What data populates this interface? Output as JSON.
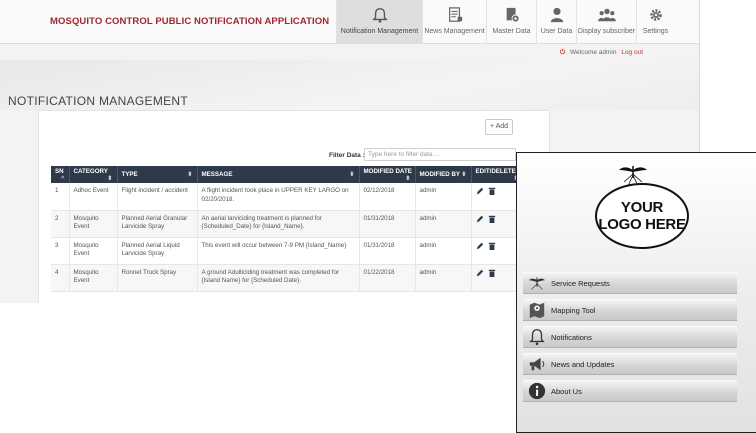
{
  "app": {
    "title": "MOSQUITO CONTROL PUBLIC NOTIFICATION APPLICATION"
  },
  "nav": {
    "items": [
      {
        "label": "Notification Management",
        "icon": "bell-icon",
        "active": true
      },
      {
        "label": "News Management",
        "icon": "news-icon",
        "active": false
      },
      {
        "label": "Master Data",
        "icon": "database-icon",
        "active": false
      },
      {
        "label": "User Data",
        "icon": "user-icon",
        "active": false
      },
      {
        "label": "Display subscriber",
        "icon": "group-icon",
        "active": false
      },
      {
        "label": "Settings",
        "icon": "gear-icon",
        "active": false
      }
    ]
  },
  "header": {
    "welcome": "Welcome admin",
    "logout": "Log out"
  },
  "page": {
    "title": "NOTIFICATION MANAGEMENT",
    "add_label": "+ Add",
    "filter_label": "Filter Data :",
    "filter_placeholder": "Type here to filter data ..."
  },
  "table": {
    "columns": [
      "SN",
      "CATEGORY",
      "TYPE",
      "MESSAGE",
      "MODIFIED DATE",
      "MODIFIED BY",
      "EDIT/DELETE"
    ],
    "rows": [
      {
        "sn": "1",
        "category": "Adhoc Event",
        "type": "Flight incident / accident",
        "message": "A flight incident took place in UPPER KEY LARGO on 02/20/2018.",
        "modified_date": "02/12/2018",
        "modified_by": "admin"
      },
      {
        "sn": "2",
        "category": "Mosquito Event",
        "type": "Planned Aerial Granular Larvicide Spray",
        "message": "An aerial larviciding treatment is planned for {Scheduled_Date} for {Island_Name}.",
        "modified_date": "01/31/2018",
        "modified_by": "admin"
      },
      {
        "sn": "3",
        "category": "Mosquito Event",
        "type": "Planned Aerial Liquid Larvicide Spray",
        "message": "This event will occur between 7-9 PM {Island_Name}",
        "modified_date": "01/31/2018",
        "modified_by": "admin"
      },
      {
        "sn": "4",
        "category": "Mosquito Event",
        "type": "Ronnet Truck Spray",
        "message": "A ground Adulticiding treatment was completed for {Island Name} for {Scheduled Date}.",
        "modified_date": "01/22/2018",
        "modified_by": "admin"
      }
    ]
  },
  "mobile": {
    "logo_line1": "YOUR",
    "logo_line2": "LOGO HERE",
    "menu": [
      {
        "label": "Service Requests",
        "icon": "mosquito-icon"
      },
      {
        "label": "Mapping Tool",
        "icon": "map-icon"
      },
      {
        "label": "Notifications",
        "icon": "bell-icon"
      },
      {
        "label": "News and Updates",
        "icon": "megaphone-icon"
      },
      {
        "label": "About Us",
        "icon": "info-icon"
      }
    ]
  },
  "colors": {
    "brand_red": "#a0262c",
    "table_header": "#2e3a4a"
  }
}
